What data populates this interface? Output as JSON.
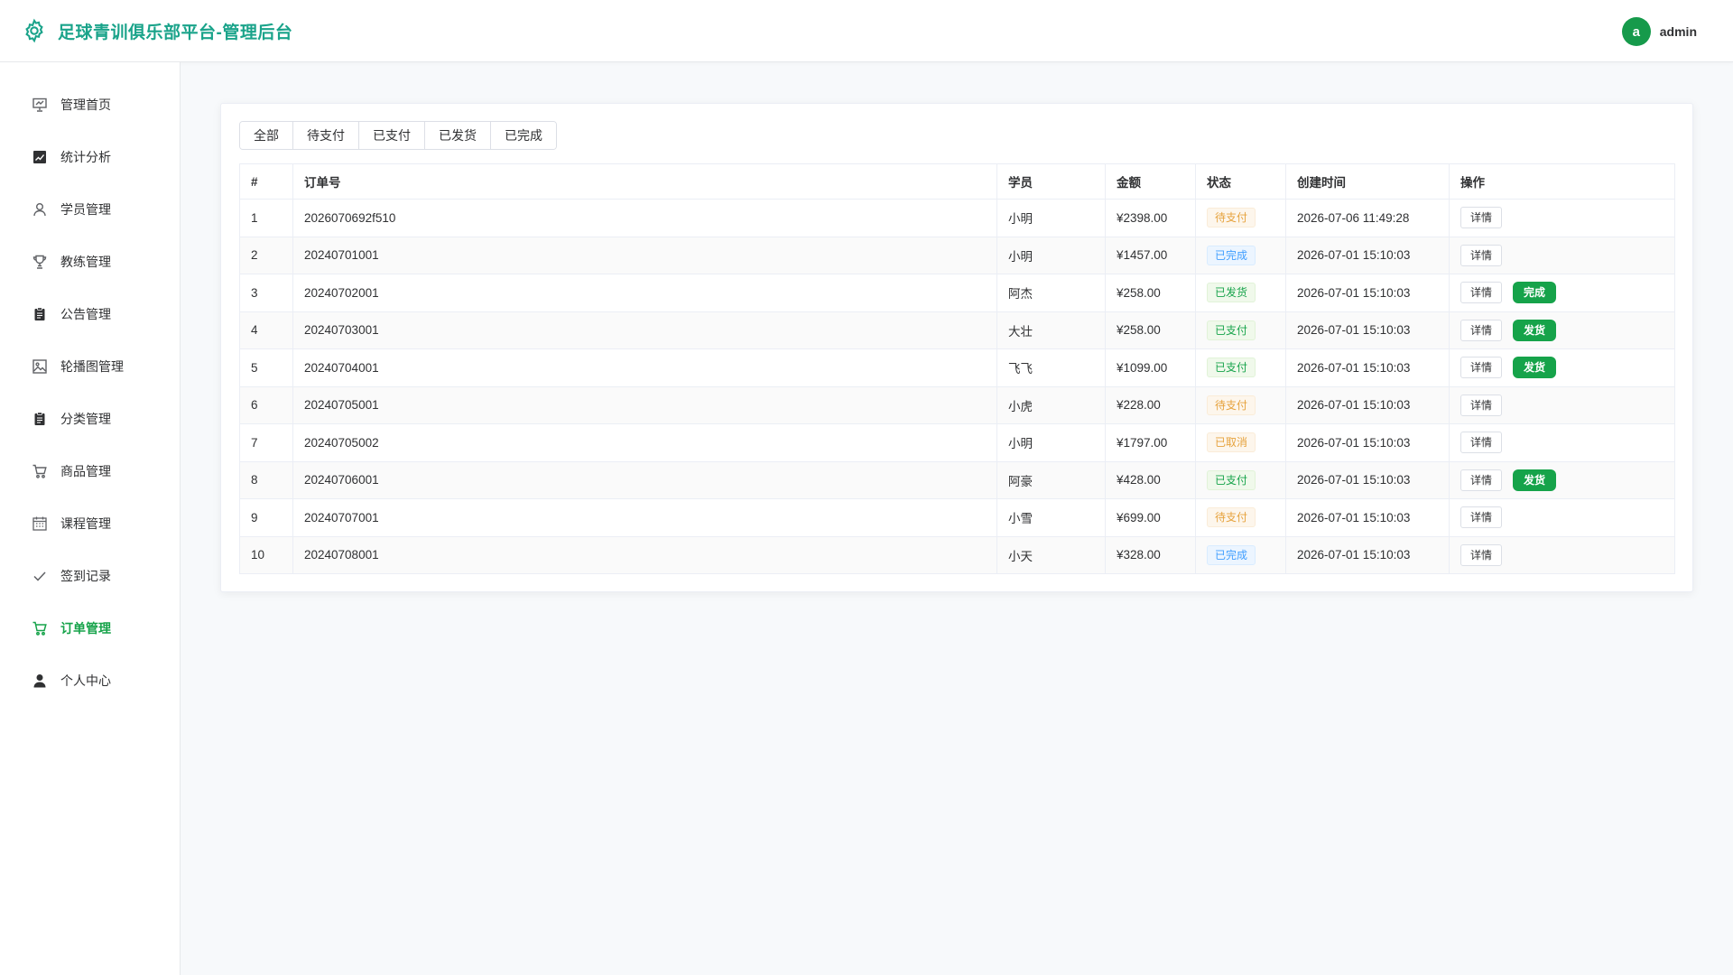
{
  "header": {
    "title": "足球青训俱乐部平台-管理后台",
    "avatar_letter": "a",
    "username": "admin"
  },
  "colors": {
    "brand": "#1aa38a",
    "primary": "#16a34a",
    "warning": "#e6a23c",
    "info": "#409eff"
  },
  "sidebar": {
    "items": [
      {
        "label": "管理首页",
        "icon": "presentation-icon"
      },
      {
        "label": "统计分析",
        "icon": "chart-icon"
      },
      {
        "label": "学员管理",
        "icon": "user-icon"
      },
      {
        "label": "教练管理",
        "icon": "trophy-icon"
      },
      {
        "label": "公告管理",
        "icon": "clipboard-icon"
      },
      {
        "label": "轮播图管理",
        "icon": "image-icon"
      },
      {
        "label": "分类管理",
        "icon": "clipboard-icon"
      },
      {
        "label": "商品管理",
        "icon": "cart-icon"
      },
      {
        "label": "课程管理",
        "icon": "calendar-icon"
      },
      {
        "label": "签到记录",
        "icon": "check-icon"
      },
      {
        "label": "订单管理",
        "icon": "cart-icon",
        "active": true
      },
      {
        "label": "个人中心",
        "icon": "user-filled-icon"
      }
    ]
  },
  "tabs": [
    "全部",
    "待支付",
    "已支付",
    "已发货",
    "已完成"
  ],
  "table": {
    "columns": [
      "#",
      "订单号",
      "学员",
      "金额",
      "状态",
      "创建时间",
      "操作"
    ],
    "detail_label": "详情",
    "rows": [
      {
        "index": "1",
        "order_no": "2026070692f510",
        "student": "小明",
        "amount": "¥2398.00",
        "status": "待支付",
        "status_type": "warn",
        "created": "2026-07-06 11:49:28",
        "action": ""
      },
      {
        "index": "2",
        "order_no": "20240701001",
        "student": "小明",
        "amount": "¥1457.00",
        "status": "已完成",
        "status_type": "info",
        "created": "2026-07-01 15:10:03",
        "action": ""
      },
      {
        "index": "3",
        "order_no": "20240702001",
        "student": "阿杰",
        "amount": "¥258.00",
        "status": "已发货",
        "status_type": "success",
        "created": "2026-07-01 15:10:03",
        "action": "完成"
      },
      {
        "index": "4",
        "order_no": "20240703001",
        "student": "大壮",
        "amount": "¥258.00",
        "status": "已支付",
        "status_type": "success",
        "created": "2026-07-01 15:10:03",
        "action": "发货"
      },
      {
        "index": "5",
        "order_no": "20240704001",
        "student": "飞飞",
        "amount": "¥1099.00",
        "status": "已支付",
        "status_type": "success",
        "created": "2026-07-01 15:10:03",
        "action": "发货"
      },
      {
        "index": "6",
        "order_no": "20240705001",
        "student": "小虎",
        "amount": "¥228.00",
        "status": "待支付",
        "status_type": "warn",
        "created": "2026-07-01 15:10:03",
        "action": ""
      },
      {
        "index": "7",
        "order_no": "20240705002",
        "student": "小明",
        "amount": "¥1797.00",
        "status": "已取消",
        "status_type": "warn",
        "created": "2026-07-01 15:10:03",
        "action": ""
      },
      {
        "index": "8",
        "order_no": "20240706001",
        "student": "阿豪",
        "amount": "¥428.00",
        "status": "已支付",
        "status_type": "success",
        "created": "2026-07-01 15:10:03",
        "action": "发货"
      },
      {
        "index": "9",
        "order_no": "20240707001",
        "student": "小雪",
        "amount": "¥699.00",
        "status": "待支付",
        "status_type": "warn",
        "created": "2026-07-01 15:10:03",
        "action": ""
      },
      {
        "index": "10",
        "order_no": "20240708001",
        "student": "小天",
        "amount": "¥328.00",
        "status": "已完成",
        "status_type": "info",
        "created": "2026-07-01 15:10:03",
        "action": ""
      }
    ]
  }
}
